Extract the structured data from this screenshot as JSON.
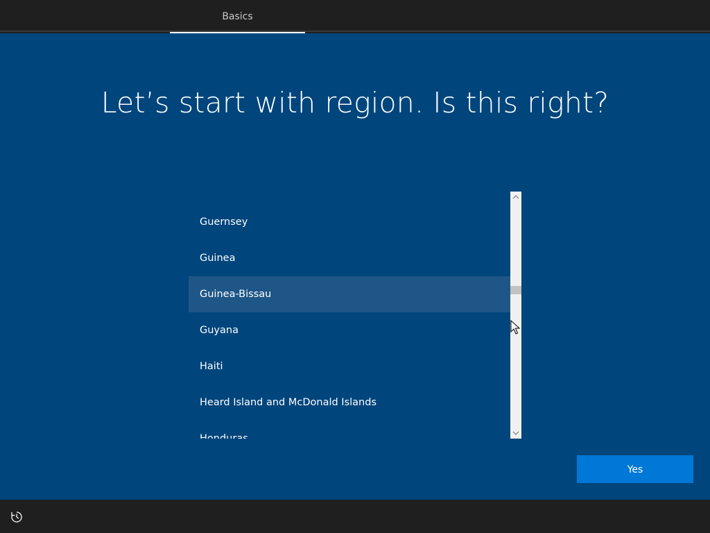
{
  "header": {
    "tab_label": "Basics"
  },
  "main": {
    "title": "Let’s start with region. Is this right?",
    "region_list": {
      "items": [
        {
          "label": "Guernsey",
          "selected": false
        },
        {
          "label": "Guinea",
          "selected": false
        },
        {
          "label": "Guinea-Bissau",
          "selected": true
        },
        {
          "label": "Guyana",
          "selected": false
        },
        {
          "label": "Haiti",
          "selected": false
        },
        {
          "label": "Heard Island and McDonald Islands",
          "selected": false
        },
        {
          "label": "Honduras",
          "selected": false
        }
      ]
    },
    "confirm_button_label": "Yes"
  },
  "footer": {
    "icon": "ease-of-access-icon"
  },
  "colors": {
    "background": "#00457c",
    "selected_item": "#1e5687",
    "accent_button": "#0078d7",
    "chrome": "#1f1f1f"
  }
}
